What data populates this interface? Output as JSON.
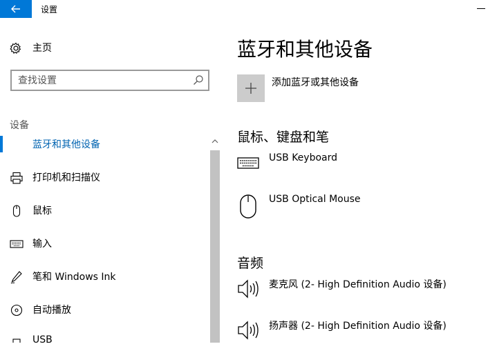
{
  "app": {
    "title": "设置"
  },
  "sidebar": {
    "home_label": "主页",
    "search_placeholder": "查找设置",
    "section_label": "设备",
    "items": [
      {
        "label": "蓝牙和其他设备",
        "icon": "bluetooth-icon",
        "active": true
      },
      {
        "label": "打印机和扫描仪",
        "icon": "printer-icon"
      },
      {
        "label": "鼠标",
        "icon": "mouse-icon"
      },
      {
        "label": "输入",
        "icon": "keyboard-icon"
      },
      {
        "label": "笔和 Windows Ink",
        "icon": "pen-icon"
      },
      {
        "label": "自动播放",
        "icon": "autoplay-icon"
      },
      {
        "label": "USB",
        "icon": "usb-icon"
      }
    ]
  },
  "main": {
    "title": "蓝牙和其他设备",
    "add_device_label": "添加蓝牙或其他设备",
    "groups": [
      {
        "heading": "鼠标、键盘和笔",
        "devices": [
          {
            "name": "USB Keyboard",
            "icon": "keyboard-icon"
          },
          {
            "name": "USB Optical Mouse",
            "icon": "mouse-icon"
          }
        ]
      },
      {
        "heading": "音频",
        "devices": [
          {
            "name": "麦克风 (2- High Definition Audio 设备)",
            "icon": "speaker-icon"
          },
          {
            "name": "扬声器 (2- High Definition Audio 设备)",
            "icon": "speaker-icon"
          }
        ]
      }
    ]
  },
  "colors": {
    "accent": "#0078d7",
    "active_text": "#0063b1",
    "tile": "#cccccc"
  }
}
